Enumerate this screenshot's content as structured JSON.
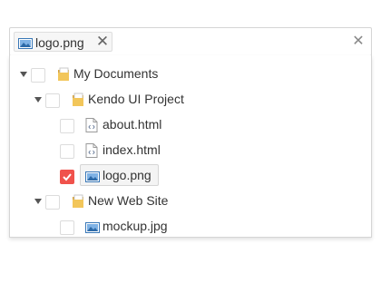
{
  "selection": {
    "tags": [
      {
        "label": "logo.png",
        "icon": "image-file-icon"
      }
    ],
    "remove_glyph": "✕",
    "clear_glyph": "✕"
  },
  "tree": {
    "nodes": [
      {
        "label": "My Documents",
        "type": "folder",
        "expanded": true,
        "checked": false
      },
      {
        "label": "Kendo UI Project",
        "type": "folder",
        "expanded": true,
        "checked": false
      },
      {
        "label": "about.html",
        "type": "html-file",
        "checked": false
      },
      {
        "label": "index.html",
        "type": "html-file",
        "checked": false
      },
      {
        "label": "logo.png",
        "type": "image-file",
        "checked": true,
        "selected": true
      },
      {
        "label": "New Web Site",
        "type": "folder",
        "expanded": true,
        "checked": false
      },
      {
        "label": "mockup.jpg",
        "type": "image-file",
        "checked": false
      }
    ]
  },
  "colors": {
    "checked_accent": "#f0524c",
    "border": "#d5d5d5",
    "folder": "#e8b84a",
    "image_icon": "#3a78b7"
  }
}
